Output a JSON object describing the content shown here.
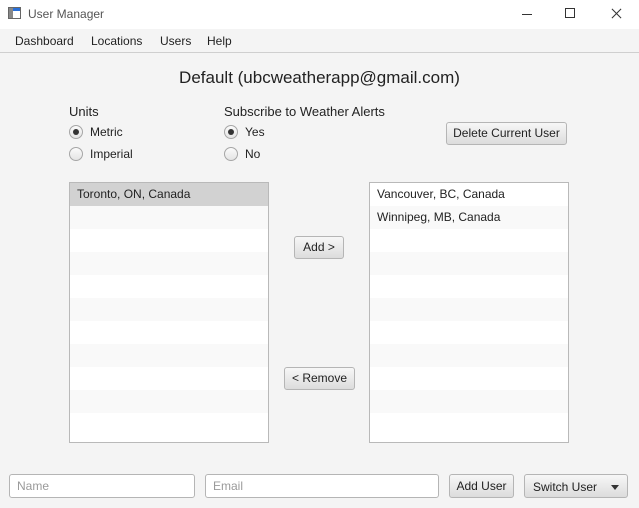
{
  "window": {
    "title": "User Manager"
  },
  "menu": [
    "Dashboard",
    "Locations",
    "Users",
    "Help"
  ],
  "header": {
    "title": "Default (ubcweatherapp@gmail.com)"
  },
  "units": {
    "label": "Units",
    "options": [
      {
        "label": "Metric",
        "selected": true
      },
      {
        "label": "Imperial",
        "selected": false
      }
    ]
  },
  "alerts": {
    "label": "Subscribe to Weather Alerts",
    "options": [
      {
        "label": "Yes",
        "selected": true
      },
      {
        "label": "No",
        "selected": false
      }
    ]
  },
  "buttons": {
    "delete_user": "Delete Current User",
    "add": "Add >",
    "remove": "< Remove",
    "add_user": "Add User"
  },
  "available_locations": [
    "Toronto, ON, Canada"
  ],
  "selected_locations": [
    "Vancouver, BC, Canada",
    "Winnipeg, MB, Canada"
  ],
  "new_user": {
    "name_placeholder": "Name",
    "email_placeholder": "Email",
    "name_value": "",
    "email_value": ""
  },
  "switch_user": {
    "label": "Switch User"
  }
}
